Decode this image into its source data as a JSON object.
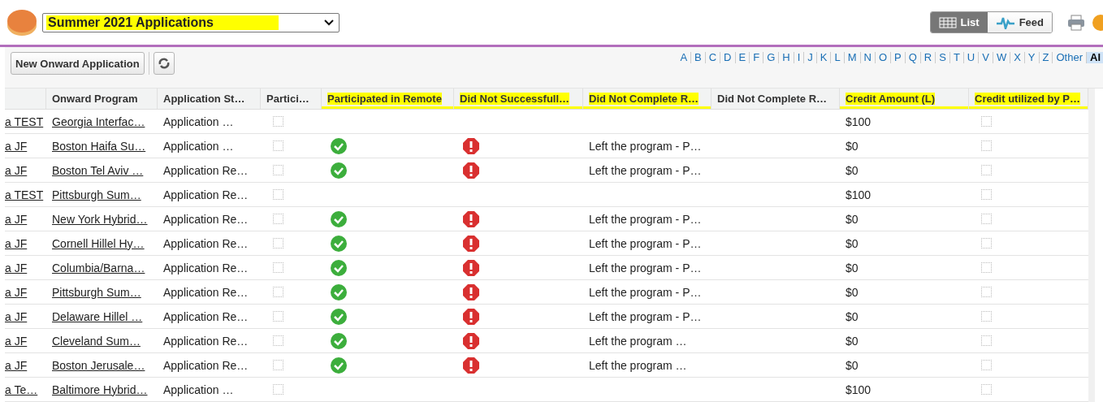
{
  "header": {
    "list_view": {
      "value": "Summer 2021 Applications",
      "highlighted": true
    },
    "view_toggle": [
      {
        "label": "List",
        "kind": "list",
        "selected": true
      },
      {
        "label": "Feed",
        "kind": "feed",
        "selected": false
      }
    ]
  },
  "toolbar": {
    "new_button": "New Onward Application",
    "letters": [
      {
        "label": "A",
        "selected": false
      },
      {
        "label": "B",
        "selected": false
      },
      {
        "label": "C",
        "selected": false
      },
      {
        "label": "D",
        "selected": false
      },
      {
        "label": "E",
        "selected": false
      },
      {
        "label": "F",
        "selected": false
      },
      {
        "label": "G",
        "selected": false
      },
      {
        "label": "H",
        "selected": false
      },
      {
        "label": "I",
        "selected": false
      },
      {
        "label": "J",
        "selected": false
      },
      {
        "label": "K",
        "selected": false
      },
      {
        "label": "L",
        "selected": false
      },
      {
        "label": "M",
        "selected": false
      },
      {
        "label": "N",
        "selected": false
      },
      {
        "label": "O",
        "selected": false
      },
      {
        "label": "P",
        "selected": false
      },
      {
        "label": "Q",
        "selected": false
      },
      {
        "label": "R",
        "selected": false
      },
      {
        "label": "S",
        "selected": false
      },
      {
        "label": "T",
        "selected": false
      },
      {
        "label": "U",
        "selected": false
      },
      {
        "label": "V",
        "selected": false
      },
      {
        "label": "W",
        "selected": false
      },
      {
        "label": "X",
        "selected": false
      },
      {
        "label": "Y",
        "selected": false
      },
      {
        "label": "Z",
        "selected": false
      },
      {
        "label": "Other",
        "selected": false
      },
      {
        "label": "Al",
        "selected": true
      }
    ]
  },
  "table": {
    "columns": [
      {
        "highlighted": false
      },
      {
        "label": "Onward Program",
        "highlighted": false
      },
      {
        "label": "Application St…",
        "highlighted": false
      },
      {
        "label": "Partici…",
        "highlighted": false
      },
      {
        "label": "Participated in Remote",
        "highlighted": true
      },
      {
        "label": "Did Not Successfull…",
        "highlighted": true
      },
      {
        "label": "Did Not Complete R…",
        "highlighted": true
      },
      {
        "label": "Did Not Complete R…",
        "highlighted": false
      },
      {
        "label": "Credit Amount (L)",
        "highlighted": true
      },
      {
        "label": "Credit utilized by P…",
        "highlighted": true
      }
    ],
    "rows": [
      {
        "column_1": "a TEST",
        "program": "Georgia Interfac…",
        "status": "Application …",
        "participated": false,
        "remote": false,
        "not_successful": false,
        "credit": "$100",
        "credit_utilized": false
      },
      {
        "column_1": "a JF",
        "program": "Boston Haifa Su…",
        "status": "Application …",
        "participated": false,
        "remote": true,
        "not_successful": true,
        "reason": "Left the program - P…",
        "credit": "$0",
        "credit_utilized": false
      },
      {
        "column_1": "a JF",
        "program": "Boston Tel Aviv …",
        "status": "Application Re…",
        "participated": false,
        "remote": true,
        "not_successful": true,
        "reason": "Left the program - P…",
        "credit": "$0",
        "credit_utilized": false
      },
      {
        "column_1": "a TEST",
        "program": "Pittsburgh Sum…",
        "status": "Application Re…",
        "participated": false,
        "remote": false,
        "not_successful": false,
        "credit": "$100",
        "credit_utilized": false
      },
      {
        "column_1": "a JF",
        "program": "New York Hybrid…",
        "status": "Application Re…",
        "participated": false,
        "remote": true,
        "not_successful": true,
        "reason": "Left the program - P…",
        "credit": "$0",
        "credit_utilized": false
      },
      {
        "column_1": "a JF",
        "program": "Cornell Hillel Hy…",
        "status": "Application Re…",
        "participated": false,
        "remote": true,
        "not_successful": true,
        "reason": "Left the program - P…",
        "credit": "$0",
        "credit_utilized": false
      },
      {
        "column_1": "a JF",
        "program": "Columbia/Barna…",
        "status": "Application Re…",
        "participated": false,
        "remote": true,
        "not_successful": true,
        "reason": "Left the program - P…",
        "credit": "$0",
        "credit_utilized": false
      },
      {
        "column_1": "a JF",
        "program": "Pittsburgh Sum…",
        "status": "Application Re…",
        "participated": false,
        "remote": true,
        "not_successful": true,
        "reason": "Left the program - P…",
        "credit": "$0",
        "credit_utilized": false
      },
      {
        "column_1": "a JF",
        "program": "Delaware Hillel …",
        "status": "Application Re…",
        "participated": false,
        "remote": true,
        "not_successful": true,
        "reason": "Left the program - P…",
        "credit": "$0",
        "credit_utilized": false
      },
      {
        "column_1": "a JF",
        "program": "Cleveland Sum…",
        "status": "Application Re…",
        "participated": false,
        "remote": true,
        "not_successful": true,
        "reason": "Left the program …",
        "credit": "$0",
        "credit_utilized": false
      },
      {
        "column_1": "a JF",
        "program": "Boston Jerusale…",
        "status": "Application Re…",
        "participated": false,
        "remote": true,
        "not_successful": true,
        "reason": "Left the program …",
        "credit": "$0",
        "credit_utilized": false
      },
      {
        "column_1": "a Te…",
        "program": "Baltimore Hybrid…",
        "status": "Application …",
        "participated": false,
        "remote": false,
        "not_successful": false,
        "credit": "$100",
        "credit_utilized": false
      }
    ]
  }
}
